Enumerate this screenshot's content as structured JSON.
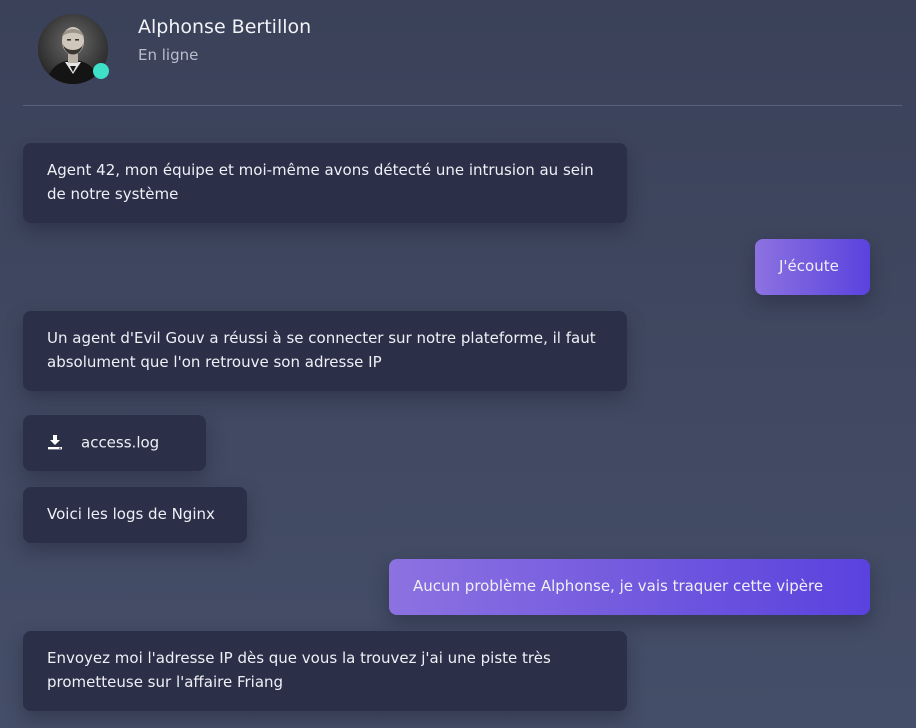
{
  "contact": {
    "name": "Alphonse Bertillon",
    "status": "En ligne",
    "avatar_icon": "portrait-avatar",
    "online_color": "#3ee0c8"
  },
  "messages": [
    {
      "direction": "incoming",
      "text": "Agent 42, mon équipe et moi-même avons détecté une intrusion au sein de notre système"
    },
    {
      "direction": "outgoing",
      "text": "J'écoute"
    },
    {
      "direction": "incoming",
      "text": "Un agent d'Evil Gouv a réussi à se connecter sur notre plateforme, il faut absolument que l'on retrouve son adresse IP"
    },
    {
      "direction": "incoming",
      "type": "file",
      "icon": "download-icon",
      "filename": "access.log"
    },
    {
      "direction": "incoming",
      "text": "Voici les logs de Nginx"
    },
    {
      "direction": "outgoing",
      "text": "Aucun problème Alphonse, je vais traquer cette vipère"
    },
    {
      "direction": "incoming",
      "text": "Envoyez moi l'adresse IP dès que vous la trouvez j'ai une piste très prometteuse sur l'affaire Friang"
    }
  ],
  "colors": {
    "incoming_bubble": "#2b2f48",
    "outgoing_gradient_start": "#8c72e0",
    "outgoing_gradient_end": "#5a42de"
  }
}
